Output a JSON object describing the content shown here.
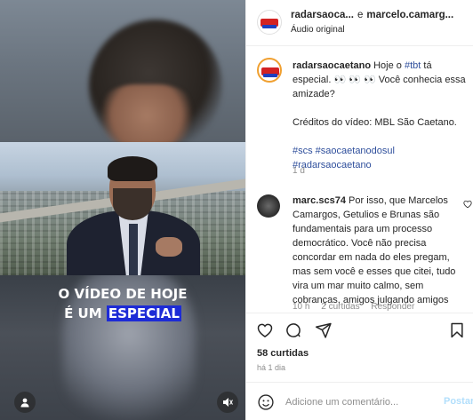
{
  "video": {
    "caption_line1": "O VÍDEO DE HOJE",
    "caption_line2_pre": "É UM ",
    "caption_line2_highlight": "ESPECIAL",
    "highlight_color": "#1d2bd6",
    "icons": {
      "user": "user-icon",
      "mute": "mute-icon"
    }
  },
  "header": {
    "account1": "radarsaoca...",
    "separator": "e",
    "account2": "marcelo.camarg...",
    "audio": "Áudio original"
  },
  "post": {
    "username": "radarsaocaetano",
    "text_a": "Hoje o",
    "hashtag_tbt": "#tbt",
    "text_b": "tá especial. 👀 👀 👀 Você conhecia essa amizade?",
    "credits": "Créditos do vídeo: MBL São Caetano.",
    "hashtags_line1": "#scs #saocaetanodosul",
    "hashtags_line2": "#radarsaocaetano",
    "time": "1 d"
  },
  "comment": {
    "username": "marc.scs74",
    "text": "Por isso, que Marcelos Camargos, Getulios e Brunas são fundamentais para um processo democrático. Você não precisa concordar em nada do eles pregam, mas sem você e esses que citei, tudo vira um mar muito calmo, sem cobranças, amigos julgando amigos",
    "meta_time": "10 h",
    "meta_likes": "2 curtidas",
    "meta_reply": "Responder"
  },
  "actions": {
    "likes": "58 curtidas",
    "ago": "há 1 dia"
  },
  "composer": {
    "placeholder": "Adicione um comentário...",
    "post_label": "Postar"
  },
  "colors": {
    "hashtag": "#2f4f9c",
    "post_button": "#b2dffc"
  }
}
